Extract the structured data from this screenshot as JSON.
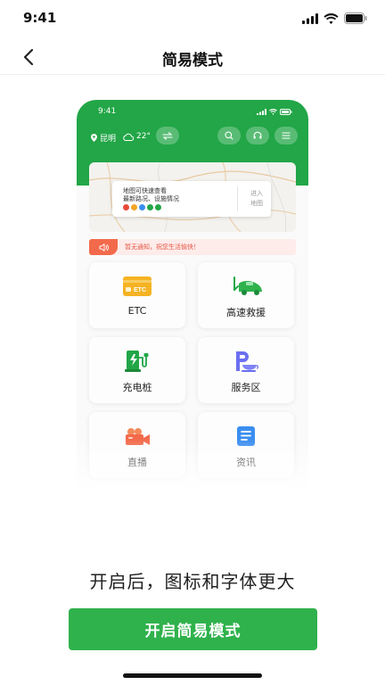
{
  "status_bar": {
    "time": "9:41"
  },
  "nav": {
    "title": "简易模式"
  },
  "preview": {
    "status_time": "9:41",
    "location": "昆明",
    "temperature": "22°",
    "map": {
      "line1": "地图可快速查看",
      "line2": "最新路况、设施情况",
      "enter_line1": "进入",
      "enter_line2": "地图",
      "dot_colors": [
        "#e84a3c",
        "#f5a623",
        "#3b8ef0",
        "#22a647",
        "#22a647"
      ]
    },
    "notice": "暂无通知，祝您生活愉快！",
    "tiles": [
      {
        "label": "ETC",
        "icon": "etc-card-icon"
      },
      {
        "label": "高速救援",
        "icon": "tow-truck-icon"
      },
      {
        "label": "充电桩",
        "icon": "charging-pile-icon"
      },
      {
        "label": "服务区",
        "icon": "service-area-icon"
      },
      {
        "label": "直播",
        "icon": "camera-icon"
      },
      {
        "label": "资讯",
        "icon": "news-icon"
      }
    ],
    "etc_card_text": "ETC"
  },
  "description": "开启后，图标和字体更大",
  "button": {
    "label": "开启简易模式"
  },
  "colors": {
    "brand": "#22a647",
    "button": "#2fb24c",
    "notice": "#f26a4b"
  }
}
